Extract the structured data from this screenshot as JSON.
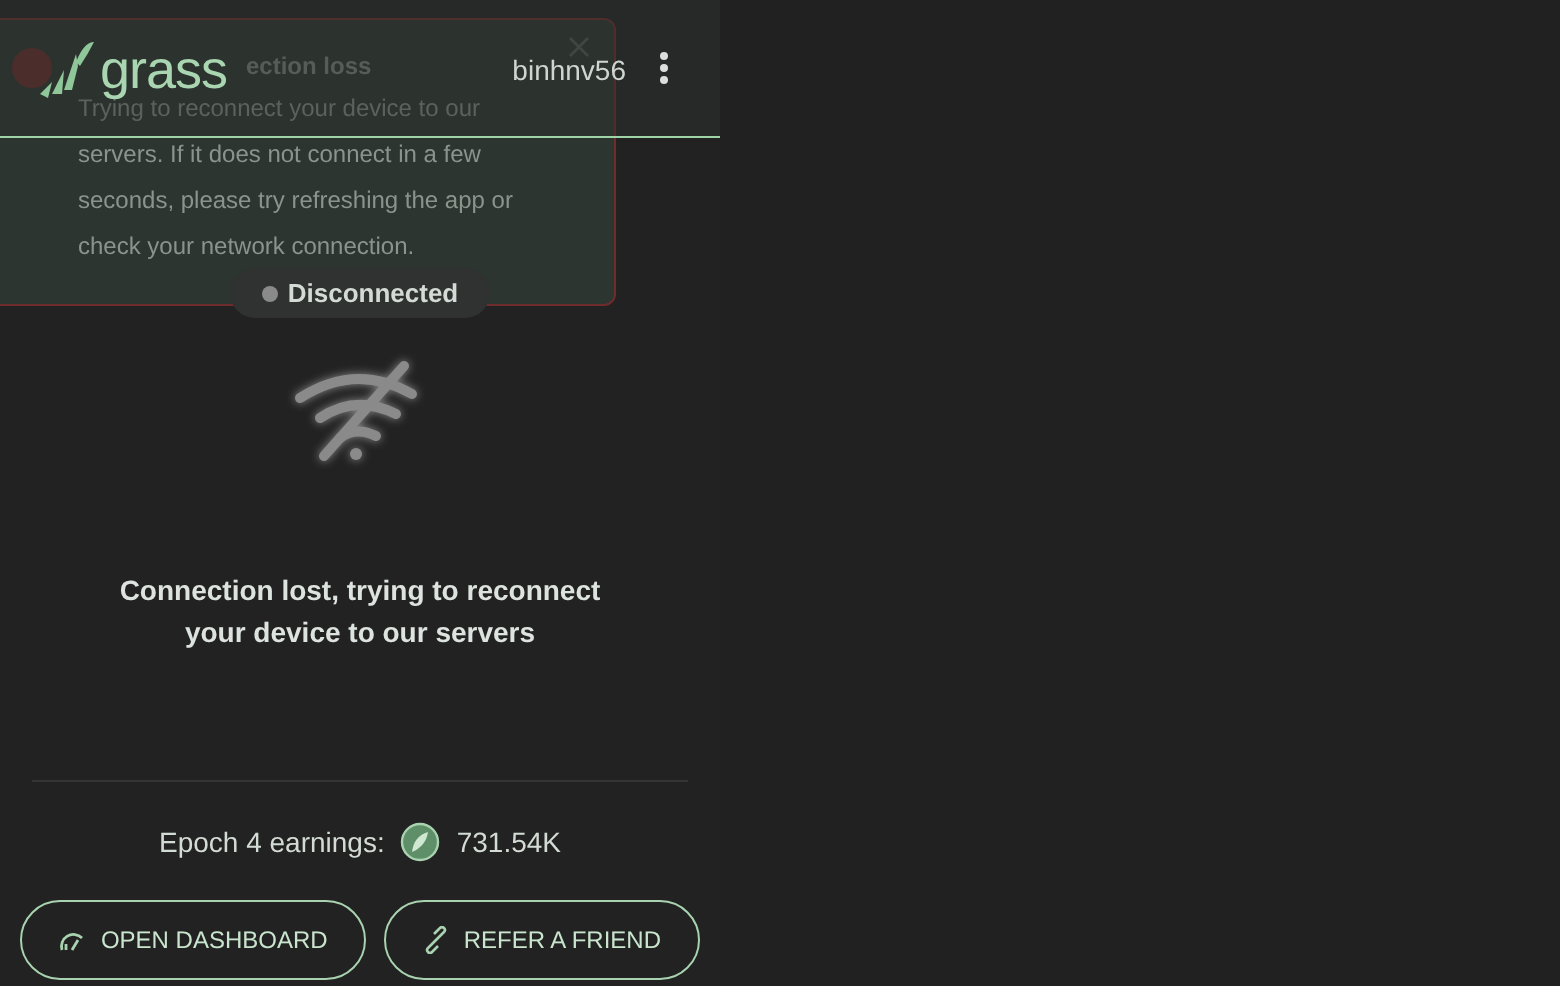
{
  "header": {
    "logo": "grass",
    "username": "binhnv56"
  },
  "toast": {
    "title": "ection loss",
    "message": "Trying to reconnect your device to our servers. If it does not connect in a few seconds, please try refreshing the app or check your network connection."
  },
  "status": {
    "label": "Disconnected",
    "connected": false
  },
  "message": "Connection lost, trying to reconnect your device to our servers",
  "earnings": {
    "label": "Epoch 4 earnings:",
    "value": "731.54K"
  },
  "buttons": [
    {
      "label": "OPEN DASHBOARD",
      "kind": "dashboard"
    },
    {
      "label": "REFER A FRIEND",
      "kind": "refer"
    }
  ]
}
